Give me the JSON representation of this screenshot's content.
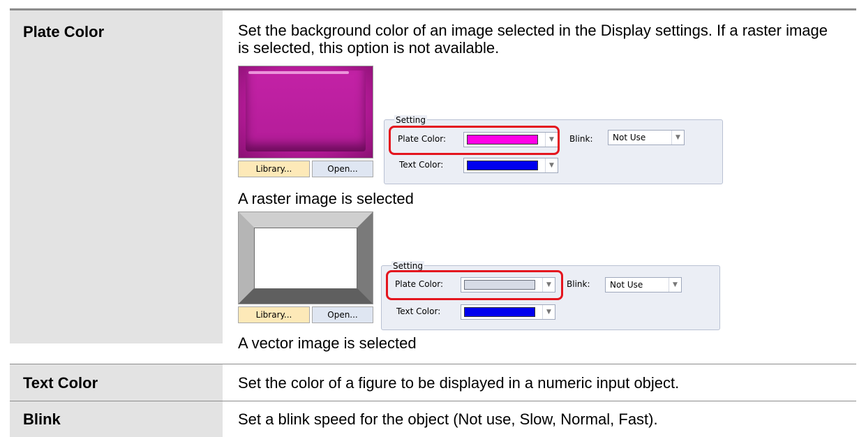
{
  "rows": [
    {
      "term": "Plate Color",
      "description": "Set the background color of an image selected in the Display settings. If a raster image is selected, this option is not available.",
      "examples": [
        {
          "preview": {
            "library_label": "Library...",
            "open_label": "Open...",
            "image_kind": "raster"
          },
          "setting": {
            "legend": "Setting",
            "plate_color_label": "Plate Color:",
            "plate_color_swatch": "#ff00e6",
            "blink_label": "Blink:",
            "blink_value": "Not Use",
            "text_color_label": "Text Color:",
            "text_color_swatch": "#0000ee"
          },
          "caption": "A raster image is selected"
        },
        {
          "preview": {
            "library_label": "Library...",
            "open_label": "Open...",
            "image_kind": "vector"
          },
          "setting": {
            "legend": "Setting",
            "plate_color_label": "Plate Color:",
            "plate_color_swatch": "#d6dbe6",
            "blink_label": "Blink:",
            "blink_value": "Not Use",
            "text_color_label": "Text Color:",
            "text_color_swatch": "#0000ee"
          },
          "caption": "A vector image is selected"
        }
      ]
    },
    {
      "term": "Text Color",
      "description": "Set the color of a figure to be displayed in a numeric input object."
    },
    {
      "term": "Blink",
      "description": "Set a blink speed for the object (Not use, Slow, Normal, Fast)."
    }
  ],
  "colors": {
    "header_rule": "#8c8c8c",
    "term_column_bg": "#e3e3e3",
    "highlight_box": "#e4151e"
  }
}
